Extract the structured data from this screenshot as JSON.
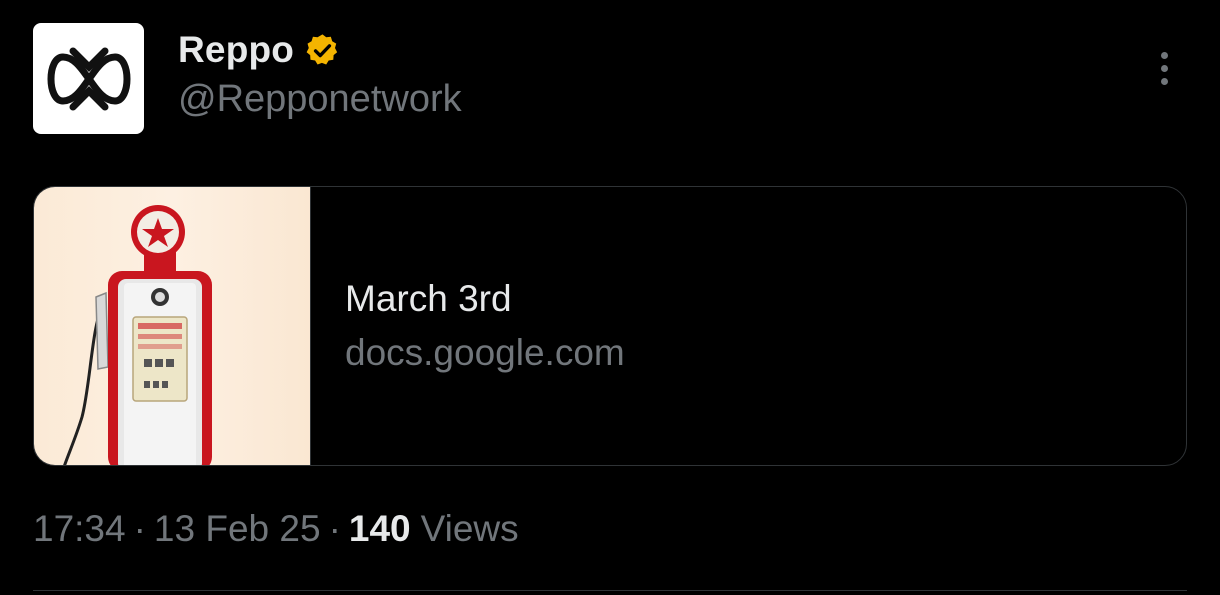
{
  "author": {
    "display_name": "Reppo",
    "handle": "@Repponetwork",
    "verified_badge_color": "#f4b400",
    "avatar_icon": "infinity-knot-logo-icon"
  },
  "card": {
    "title": "March 3rd",
    "domain": "docs.google.com",
    "image": "vintage-gas-pump-illustration"
  },
  "meta": {
    "time": "17:34",
    "separator": "·",
    "date": "13 Feb 25",
    "views_count": "140",
    "views_label": "Views"
  },
  "colors": {
    "background": "#000000",
    "primary_text": "#e7e9ea",
    "secondary_text": "#71767b",
    "border": "#2f3336"
  }
}
